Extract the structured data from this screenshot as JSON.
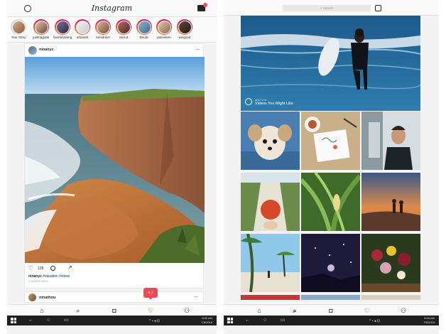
{
  "left": {
    "header": {
      "logo": "Instagram"
    },
    "stories": [
      {
        "name": "Your Story",
        "own": true
      },
      {
        "name": "justinagotar"
      },
      {
        "name": "facetimeiwngs"
      },
      {
        "name": "urbanart"
      },
      {
        "name": "tomstravs"
      },
      {
        "name": "zara.d"
      },
      {
        "name": "Boutic"
      },
      {
        "name": "jasminem"
      },
      {
        "name": "wingood"
      }
    ],
    "post": {
      "username": "ninanyc",
      "more": "…",
      "likes": "128",
      "caption_user": "ninanyc",
      "caption_text": "#vacation #views",
      "ago": "2 HOURS AGO"
    },
    "post2": {
      "username": "ninathou",
      "more": "…"
    },
    "notification": {
      "count": "1"
    },
    "taskbar": {
      "time": "8:00 AM",
      "date": "7/8/2016"
    }
  },
  "right": {
    "search": {
      "placeholder": "Search"
    },
    "video": {
      "watch_label": "WATCH",
      "title": "Videos You Might Like"
    },
    "taskbar": {
      "time": "8:00 AM",
      "date": "7/8/2016"
    }
  },
  "colors": {
    "accent": "#ed4956",
    "link": "#003569",
    "taskbar": "#1f1f1f"
  }
}
